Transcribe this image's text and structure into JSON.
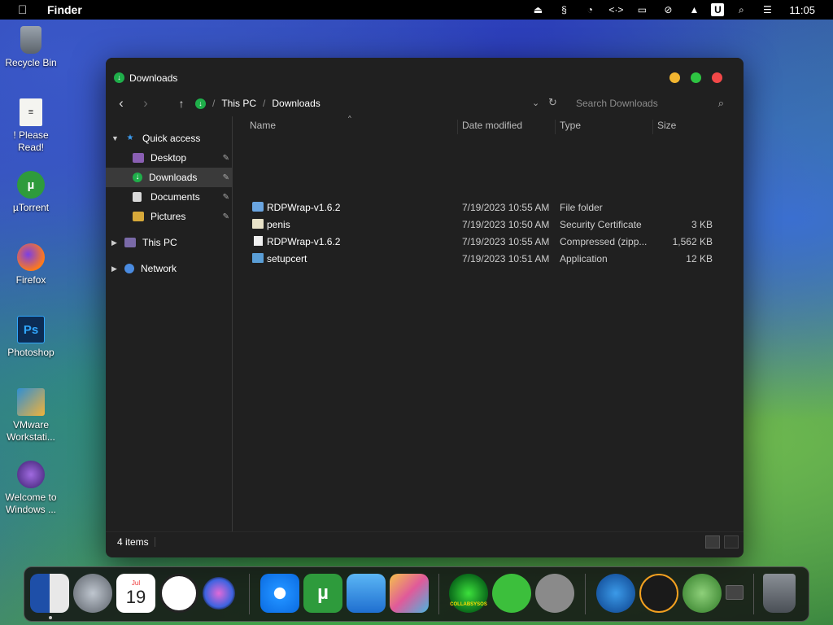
{
  "menubar": {
    "app_name": "Finder",
    "clock": "11:05",
    "icons": [
      "apple-icon",
      "eject-icon",
      "script-icon",
      "pie-chart-icon",
      "code-icon",
      "display-icon",
      "mute-icon",
      "eject-alt-icon",
      "u-icon",
      "search-icon",
      "control-center-icon"
    ]
  },
  "desktop": {
    "icons": [
      {
        "name": "recycle-bin-icon",
        "label": "Recycle Bin"
      },
      {
        "name": "please-read-icon",
        "label": "! Please Read!"
      },
      {
        "name": "utorrent-icon",
        "label": "µTorrent"
      },
      {
        "name": "firefox-icon",
        "label": "Firefox"
      },
      {
        "name": "photoshop-icon",
        "label": "Photoshop"
      },
      {
        "name": "vmware-icon",
        "label": "VMware Workstati..."
      },
      {
        "name": "welcome-icon",
        "label": "Welcome to Windows ..."
      }
    ]
  },
  "window": {
    "title": "Downloads",
    "breadcrumb": [
      "This PC",
      "Downloads"
    ],
    "search": {
      "placeholder": "Search Downloads",
      "value": ""
    },
    "sidebar": {
      "quick_access": "Quick access",
      "items": [
        {
          "label": "Desktop",
          "icon": "desktop-icon",
          "pinned": true
        },
        {
          "label": "Downloads",
          "icon": "downloads-icon",
          "pinned": true,
          "selected": true
        },
        {
          "label": "Documents",
          "icon": "documents-icon",
          "pinned": true
        },
        {
          "label": "Pictures",
          "icon": "pictures-icon",
          "pinned": true
        }
      ],
      "this_pc": "This PC",
      "network": "Network"
    },
    "columns": [
      "Name",
      "Date modified",
      "Type",
      "Size"
    ],
    "files": [
      {
        "name": "RDPWrap-v1.6.2",
        "date": "7/19/2023 10:55 AM",
        "type": "File folder",
        "size": "",
        "icon": "folder-icon"
      },
      {
        "name": "penis",
        "date": "7/19/2023 10:50 AM",
        "type": "Security Certificate",
        "size": "3 KB",
        "icon": "certificate-icon"
      },
      {
        "name": "RDPWrap-v1.6.2",
        "date": "7/19/2023 10:55 AM",
        "type": "Compressed (zipp...",
        "size": "1,562 KB",
        "icon": "zip-icon"
      },
      {
        "name": "setupcert",
        "date": "7/19/2023 10:51 AM",
        "type": "Application",
        "size": "12 KB",
        "icon": "application-icon"
      }
    ],
    "status": "4 items"
  },
  "dock": {
    "items": [
      "finder-icon",
      "launchpad-icon",
      "calendar-icon",
      "clock-icon",
      "siri-icon",
      "safari-icon",
      "utorrent-icon",
      "parallels-icon",
      "preview-icon",
      "collabsysos-icon",
      "link-icon",
      "tools-icon",
      "www-icon",
      "downloader-icon",
      "network-grid-icon",
      "small-window-icon",
      "trash-icon"
    ],
    "calendar_month": "Jul",
    "calendar_day": "19",
    "collabsysos_label": "COLLABSYSOS"
  }
}
